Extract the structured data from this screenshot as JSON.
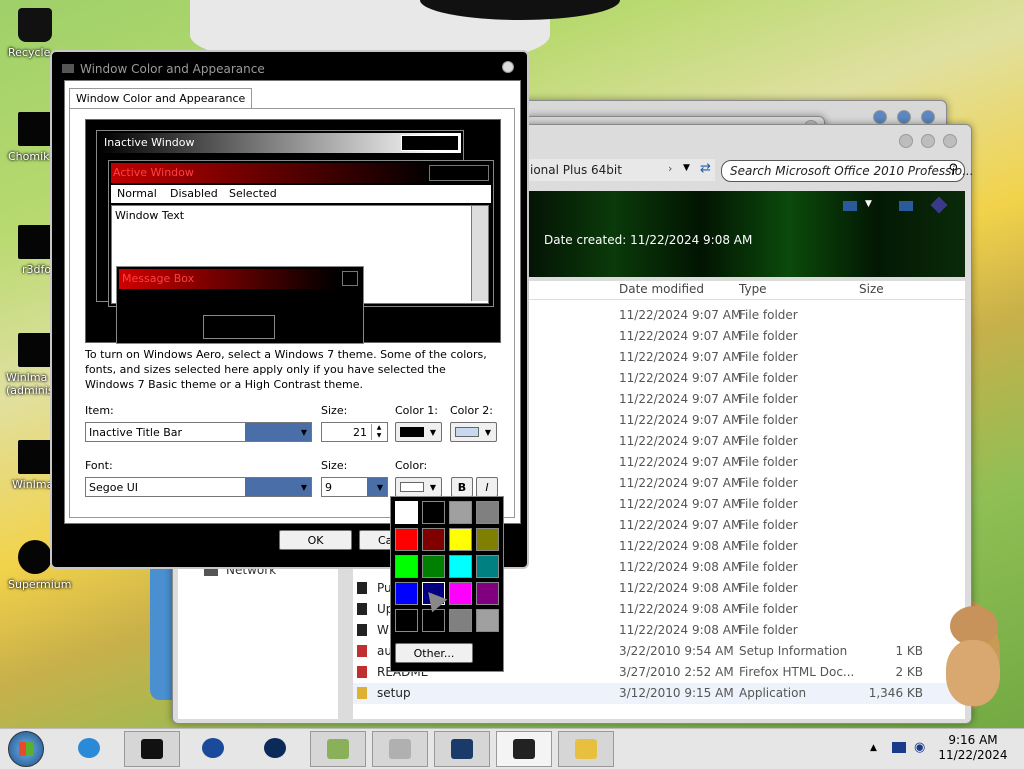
{
  "desktop": {
    "icons": [
      "Recycle",
      "Chomik",
      "r3dfo",
      "WinIma (adminis",
      "WinIma",
      "Supermium"
    ]
  },
  "explorer": {
    "address": "ional Plus 64bit",
    "search_placeholder": "Search Microsoft Office 2010 Professio...",
    "date_created": "Date created: 11/22/2024 9:08 AM",
    "columns": [
      "Date modified",
      "Type",
      "Size"
    ],
    "nav_network": "Network",
    "rows": [
      {
        "name": "",
        "date": "11/22/2024 9:07 AM",
        "type": "File folder",
        "size": ""
      },
      {
        "name": "",
        "date": "11/22/2024 9:07 AM",
        "type": "File folder",
        "size": ""
      },
      {
        "name": "",
        "date": "11/22/2024 9:07 AM",
        "type": "File folder",
        "size": ""
      },
      {
        "name": "",
        "date": "11/22/2024 9:07 AM",
        "type": "File folder",
        "size": ""
      },
      {
        "name": "",
        "date": "11/22/2024 9:07 AM",
        "type": "File folder",
        "size": ""
      },
      {
        "name": "",
        "date": "11/22/2024 9:07 AM",
        "type": "File folder",
        "size": ""
      },
      {
        "name": "",
        "date": "11/22/2024 9:07 AM",
        "type": "File folder",
        "size": ""
      },
      {
        "name": "",
        "date": "11/22/2024 9:07 AM",
        "type": "File folder",
        "size": ""
      },
      {
        "name": "",
        "date": "11/22/2024 9:07 AM",
        "type": "File folder",
        "size": ""
      },
      {
        "name": "",
        "date": "11/22/2024 9:07 AM",
        "type": "File folder",
        "size": ""
      },
      {
        "name": "",
        "date": "11/22/2024 9:07 AM",
        "type": "File folder",
        "size": ""
      },
      {
        "name": "",
        "date": "11/22/2024 9:08 AM",
        "type": "File folder",
        "size": ""
      },
      {
        "name": "",
        "date": "11/22/2024 9:08 AM",
        "type": "File folder",
        "size": ""
      },
      {
        "name": "Pu",
        "date": "11/22/2024 9:08 AM",
        "type": "File folder",
        "size": ""
      },
      {
        "name": "Up",
        "date": "11/22/2024 9:08 AM",
        "type": "File folder",
        "size": ""
      },
      {
        "name": "W",
        "date": "11/22/2024 9:08 AM",
        "type": "File folder",
        "size": ""
      },
      {
        "name": "au",
        "date": "3/22/2010 9:54 AM",
        "type": "Setup Information",
        "size": "1 KB"
      },
      {
        "name": "README",
        "date": "3/27/2010 2:52 AM",
        "type": "Firefox HTML Doc...",
        "size": "2 KB"
      },
      {
        "name": "setup",
        "date": "3/12/2010 9:15 AM",
        "type": "Application",
        "size": "1,346 KB"
      }
    ]
  },
  "dialog": {
    "title": "Window Color and Appearance",
    "tab": "Window Color and Appearance",
    "preview": {
      "inactive": "Inactive Window",
      "active": "Active Window",
      "menu": [
        "Normal",
        "Disabled",
        "Selected"
      ],
      "window_text": "Window Text",
      "message_box": "Message Box"
    },
    "info": "To turn on Windows Aero, select a Windows 7 theme.  Some of the colors, fonts, and sizes selected here apply only if you have selected the Windows 7 Basic theme or a High Contrast theme.",
    "item_label": "Item:",
    "item_value": "Inactive Title Bar",
    "size_label": "Size:",
    "size_value": "21",
    "color1_label": "Color 1:",
    "color2_label": "Color 2:",
    "font_label": "Font:",
    "font_value": "Segoe UI",
    "font_size_label": "Size:",
    "font_size_value": "9",
    "color_label": "Color:",
    "bold": "B",
    "italic": "I",
    "ok": "OK",
    "cancel": "Ca",
    "colors": {
      "color1": "#000000",
      "color2": "#c8d8f0",
      "font_color": "#ffffff"
    }
  },
  "palette": {
    "colors": [
      "#ffffff",
      "#000000",
      "#a0a0a0",
      "#808080",
      "#ff0000",
      "#800000",
      "#ffff00",
      "#808000",
      "#00ff00",
      "#008000",
      "#00ffff",
      "#008080",
      "#0000ff",
      "#000080",
      "#ff00ff",
      "#800080",
      "#000000",
      "#000000",
      "#808080",
      "#a0a0a0"
    ],
    "other": "Other..."
  },
  "taskbar": {
    "time": "9:16 AM",
    "date": "11/22/2024"
  }
}
